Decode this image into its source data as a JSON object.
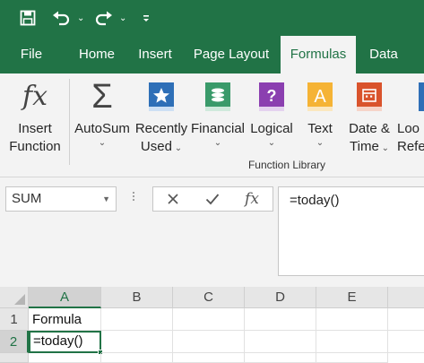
{
  "colors": {
    "brand": "#217346",
    "ribbon_bg": "#f3f3f3"
  },
  "quick_access": {
    "icons": [
      "save-icon",
      "undo-icon",
      "redo-icon",
      "customize-icon"
    ]
  },
  "tabs": [
    {
      "label": "File"
    },
    {
      "label": "Home"
    },
    {
      "label": "Insert"
    },
    {
      "label": "Page Layout"
    },
    {
      "label": "Formulas",
      "active": true
    },
    {
      "label": "Data"
    }
  ],
  "ribbon": {
    "insert_function": {
      "line1": "Insert",
      "line2": "Function",
      "icon": "fx"
    },
    "buttons": [
      {
        "line1": "AutoSum",
        "icon": "Σ"
      },
      {
        "line1": "Recently",
        "line2": "Used"
      },
      {
        "line1": "Financial"
      },
      {
        "line1": "Logical",
        "icon": "?"
      },
      {
        "line1": "Text",
        "icon": "A"
      },
      {
        "line1": "Date &",
        "line2": "Time"
      },
      {
        "line1": "Loo",
        "line2": "Refe"
      }
    ],
    "group_label": "Function Library"
  },
  "formula_bar": {
    "name_box": "SUM",
    "fx_label": "fx",
    "formula": "=today()"
  },
  "grid": {
    "columns": [
      "A",
      "B",
      "C",
      "D",
      "E"
    ],
    "rows": [
      {
        "num": "1",
        "a": "Formula"
      },
      {
        "num": "2",
        "a": "=today()"
      }
    ]
  }
}
